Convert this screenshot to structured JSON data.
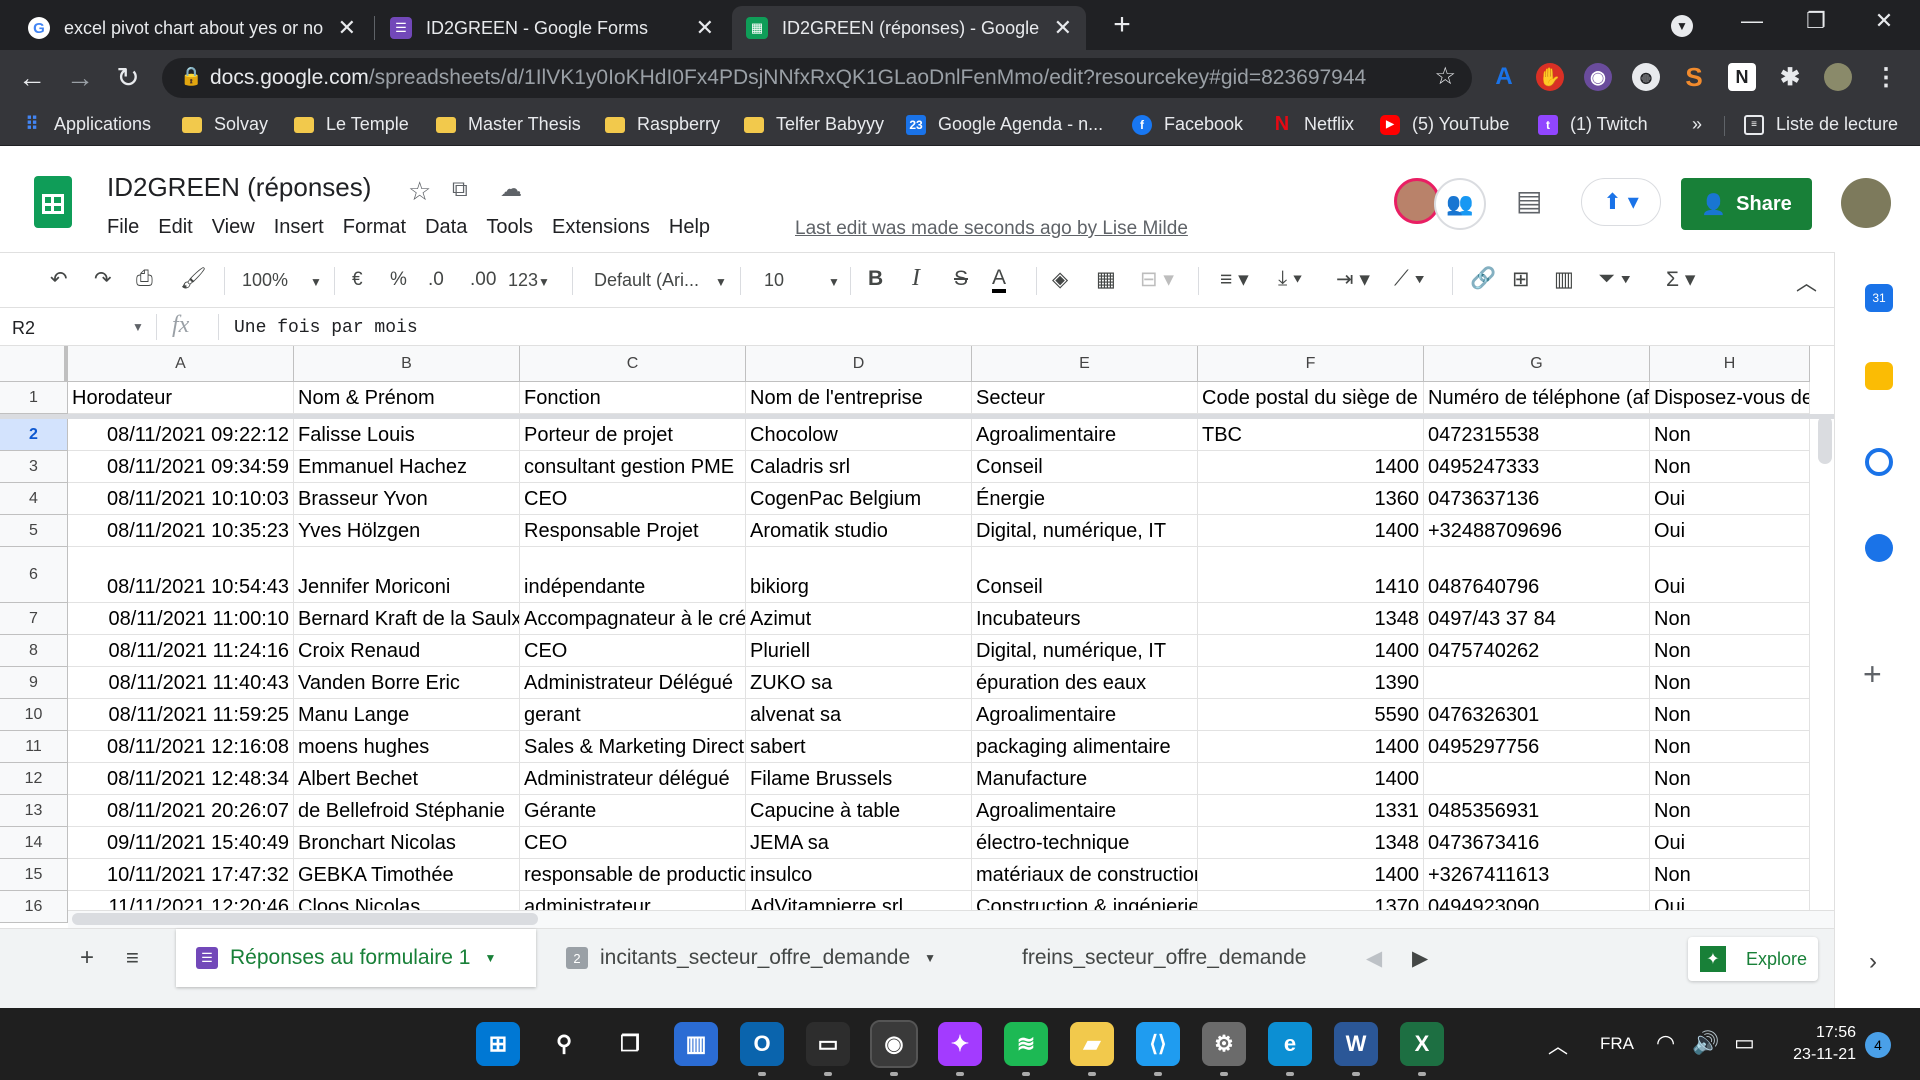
{
  "browser": {
    "tabs": [
      {
        "title": "excel pivot chart about yes or no",
        "favicon": "google-icon",
        "active": false
      },
      {
        "title": "ID2GREEN - Google Forms",
        "favicon": "forms-icon",
        "active": false
      },
      {
        "title": "ID2GREEN (réponses) - Google Sh",
        "favicon": "sheets-icon",
        "active": true
      }
    ],
    "new_tab_label": "+",
    "url_domain": "docs.google.com",
    "url_path": "/spreadsheets/d/1IlVK1y0IoKHdI0Fx4PDsjNNfxRxQK1GLaoDnlFenMmo/edit?resourcekey#gid=823697944",
    "bookmarks": [
      {
        "label": "Applications",
        "icon": "apps-grid-icon"
      },
      {
        "label": "Solvay",
        "icon": "folder-icon"
      },
      {
        "label": "Le Temple",
        "icon": "folder-icon"
      },
      {
        "label": "Master Thesis",
        "icon": "folder-icon"
      },
      {
        "label": "Raspberry",
        "icon": "folder-icon"
      },
      {
        "label": "Telfer Babyyy",
        "icon": "folder-icon"
      },
      {
        "label": "Google Agenda - n...",
        "icon": "calendar-icon"
      },
      {
        "label": "Facebook",
        "icon": "facebook-icon"
      },
      {
        "label": "Netflix",
        "icon": "netflix-icon"
      },
      {
        "label": "(5) YouTube",
        "icon": "youtube-icon"
      },
      {
        "label": "(1) Twitch",
        "icon": "twitch-icon"
      }
    ],
    "more_bookmarks": "»",
    "reading_list": "Liste de lecture"
  },
  "sheets": {
    "title": "ID2GREEN (réponses)",
    "menu": [
      "File",
      "Edit",
      "View",
      "Insert",
      "Format",
      "Data",
      "Tools",
      "Extensions",
      "Help"
    ],
    "last_edit": "Last edit was made seconds ago by Lise Milde",
    "share_label": "Share",
    "toolbar": {
      "zoom": "100%",
      "currency": "€",
      "percent": "%",
      "dec_decrease": ".0",
      "dec_increase": ".00",
      "more_formats": "123",
      "font": "Default (Ari...",
      "font_size": "10",
      "bold": "B",
      "italic": "I",
      "strike": "S",
      "text_color": "A"
    },
    "name_box": "R2",
    "fx_label": "fx",
    "formula": "Une fois par mois",
    "columns": [
      "A",
      "B",
      "C",
      "D",
      "E",
      "F",
      "G",
      "H"
    ],
    "header_row": {
      "num": "1",
      "cells": [
        "Horodateur",
        "Nom & Prénom",
        "Fonction",
        "Nom de l'entreprise",
        "Secteur",
        "Code postal du siège de",
        "Numéro de téléphone (af",
        "Disposez-vous de"
      ]
    },
    "rows": [
      {
        "num": "2",
        "cells": [
          "08/11/2021 09:22:12",
          "Falisse Louis",
          "Porteur de projet",
          "Chocolow",
          "Agroalimentaire",
          "TBC",
          "0472315538",
          "Non"
        ]
      },
      {
        "num": "3",
        "cells": [
          "08/11/2021 09:34:59",
          "Emmanuel Hachez",
          "consultant gestion PME",
          "Caladris srl",
          "Conseil",
          "1400",
          "0495247333",
          "Non"
        ]
      },
      {
        "num": "4",
        "cells": [
          "08/11/2021 10:10:03",
          "Brasseur Yvon",
          "CEO",
          "CogenPac Belgium",
          "Énergie",
          "1360",
          "0473637136",
          "Oui"
        ]
      },
      {
        "num": "5",
        "cells": [
          "08/11/2021 10:35:23",
          "Yves Hölzgen",
          "Responsable Projet",
          "Aromatik studio",
          "Digital, numérique, IT",
          "1400",
          "+32488709696",
          "Oui"
        ]
      },
      {
        "num": "6",
        "cells": [
          "08/11/2021 10:54:43",
          "Jennifer Moriconi",
          "indépendante",
          "bikiorg",
          "Conseil",
          "1410",
          "0487640796",
          "Oui"
        ]
      },
      {
        "num": "7",
        "cells": [
          "08/11/2021 11:00:10",
          "Bernard Kraft de la Saulx",
          "Accompagnateur à le cré",
          "Azimut",
          "Incubateurs",
          "1348",
          "0497/43 37 84",
          "Non"
        ]
      },
      {
        "num": "8",
        "cells": [
          "08/11/2021 11:24:16",
          "Croix Renaud",
          "CEO",
          "Pluriell",
          "Digital, numérique, IT",
          "1400",
          "0475740262",
          "Non"
        ]
      },
      {
        "num": "9",
        "cells": [
          "08/11/2021 11:40:43",
          "Vanden Borre Eric",
          "Administrateur Délégué",
          "ZUKO sa",
          "épuration des eaux",
          "1390",
          "",
          "Non"
        ]
      },
      {
        "num": "10",
        "cells": [
          "08/11/2021 11:59:25",
          "Manu Lange",
          "gerant",
          "alvenat sa",
          "Agroalimentaire",
          "5590",
          "0476326301",
          "Non"
        ]
      },
      {
        "num": "11",
        "cells": [
          "08/11/2021 12:16:08",
          "moens hughes",
          "Sales & Marketing Directo",
          "sabert",
          "packaging alimentaire",
          "1400",
          "0495297756",
          "Non"
        ]
      },
      {
        "num": "12",
        "cells": [
          "08/11/2021 12:48:34",
          "Albert Bechet",
          "Administrateur délégué",
          "Filame Brussels",
          "Manufacture",
          "1400",
          "",
          "Non"
        ]
      },
      {
        "num": "13",
        "cells": [
          "08/11/2021 20:26:07",
          "de Bellefroid Stéphanie",
          "Gérante",
          "Capucine à table",
          "Agroalimentaire",
          "1331",
          "0485356931",
          "Non"
        ]
      },
      {
        "num": "14",
        "cells": [
          "09/11/2021 15:40:49",
          "Bronchart Nicolas",
          "CEO",
          "JEMA sa",
          "électro-technique",
          "1348",
          "0473673416",
          "Oui"
        ]
      },
      {
        "num": "15",
        "cells": [
          "10/11/2021 17:47:32",
          "GEBKA Timothée",
          "responsable de productio",
          "insulco",
          "matériaux de construction",
          "1400",
          "+3267411613",
          "Non"
        ]
      },
      {
        "num": "16",
        "cells": [
          "11/11/2021 12:20:46",
          "Cloos Nicolas",
          "administrateur",
          "AdVitampierre srl",
          "Construction & ingénierie",
          "1370",
          "0494923090",
          "Oui"
        ]
      }
    ],
    "selected_row": "2",
    "sheet_tabs": [
      {
        "label": "Réponses au formulaire 1",
        "active": true,
        "badge": ""
      },
      {
        "label": "incitants_secteur_offre_demande",
        "active": false,
        "badge": "2"
      },
      {
        "label": "freins_secteur_offre_demande",
        "active": false,
        "badge": ""
      }
    ],
    "explore_label": "Explore"
  },
  "taskbar": {
    "apps": [
      "windows-start-icon",
      "search-icon",
      "task-view-icon",
      "widgets-icon",
      "outlook-icon",
      "terminal-icon",
      "chrome-icon",
      "messenger-icon",
      "spotify-icon",
      "file-explorer-icon",
      "vscode-icon",
      "settings-icon",
      "edge-icon",
      "word-icon",
      "excel-icon"
    ],
    "language": "FRA",
    "time": "17:56",
    "date": "23-11-21",
    "notifications": "4"
  },
  "colors": {
    "sheets_green": "#188038",
    "chrome_dark": "#202124",
    "chrome_mid": "#35363a",
    "selection_blue": "#d3e3fd"
  }
}
